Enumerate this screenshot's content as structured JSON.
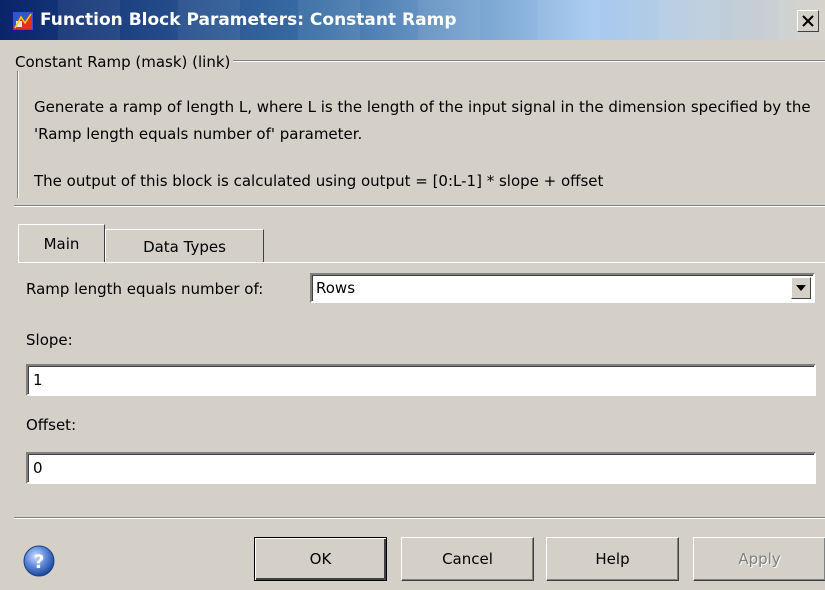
{
  "window": {
    "title": "Function Block Parameters: Constant Ramp",
    "icons": {
      "app": "simulink-block-icon",
      "close": "close-icon"
    }
  },
  "mask": {
    "legend": "Constant Ramp (mask) (link)",
    "description_line1": "Generate a ramp of length L, where L is the length of the input signal in the dimension specified by the 'Ramp length equals number of' parameter.",
    "description_line2": "The output of this block is calculated using output = [0:L-1] * slope + offset"
  },
  "tabs": [
    {
      "label": "Main",
      "active": true
    },
    {
      "label": "Data Types",
      "active": false
    }
  ],
  "params": {
    "ramp_length_label": "Ramp length equals number of:",
    "ramp_length_value": "Rows",
    "slope_label": "Slope:",
    "slope_value": "1",
    "offset_label": "Offset:",
    "offset_value": "0"
  },
  "buttons": {
    "ok": "OK",
    "cancel": "Cancel",
    "help": "Help",
    "apply": "Apply",
    "apply_enabled": false,
    "help_icon": "question-mark-icon"
  },
  "colors": {
    "titlebar_start": "#0a246a",
    "titlebar_end": "#d4d0c8",
    "dialog_bg": "#d4d0c8",
    "disabled_text": "#808080"
  }
}
